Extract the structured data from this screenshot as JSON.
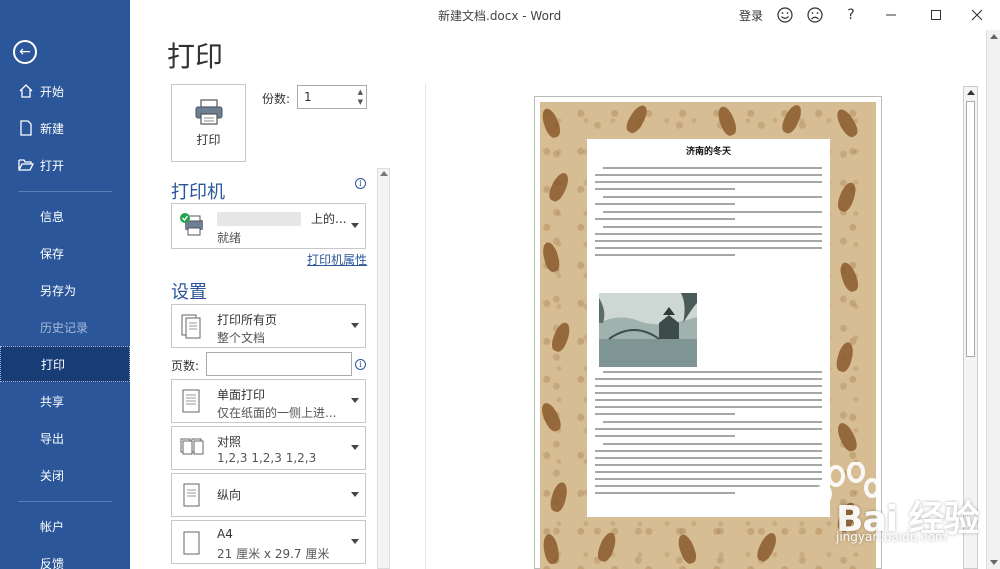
{
  "window": {
    "title": "新建文档.docx  -  Word",
    "login": "登录",
    "help": "?"
  },
  "sidebar": {
    "items": [
      {
        "label": "开始",
        "icon": "home-icon"
      },
      {
        "label": "新建",
        "icon": "new-document-icon"
      },
      {
        "label": "打开",
        "icon": "folder-open-icon"
      },
      {
        "label": "信息"
      },
      {
        "label": "保存"
      },
      {
        "label": "另存为"
      },
      {
        "label": "历史记录"
      },
      {
        "label": "打印"
      },
      {
        "label": "共享"
      },
      {
        "label": "导出"
      },
      {
        "label": "关闭"
      },
      {
        "label": "帐户"
      },
      {
        "label": "反馈"
      }
    ],
    "disabled_item": "历史记录",
    "active_item": "打印"
  },
  "print": {
    "heading": "打印",
    "print_button_label": "打印",
    "copies_label": "份数:",
    "copies_value": "1",
    "printer_section": "打印机",
    "printer_name_suffix": "上的...",
    "printer_status": "就绪",
    "printer_properties_link": "打印机属性",
    "settings_section": "设置",
    "pages_label": "页数:",
    "settings": [
      {
        "title": "打印所有页",
        "subtitle": "整个文档",
        "icon": "pages-icon"
      },
      {
        "title": "单面打印",
        "subtitle": "仅在纸面的一侧上进...",
        "icon": "one-sided-icon"
      },
      {
        "title": "对照",
        "subtitle": "1,2,3     1,2,3     1,2,3",
        "icon": "collate-icon"
      },
      {
        "title": "纵向",
        "subtitle": "",
        "icon": "portrait-icon"
      },
      {
        "title": "A4",
        "subtitle": "21 厘米 x 29.7 厘米",
        "icon": "paper-size-icon"
      }
    ]
  },
  "preview": {
    "doc_heading": "济南的冬天"
  },
  "watermark": {
    "brand": "Bai 经验",
    "url": "jingyan.baidu.com"
  },
  "colors": {
    "sidebar_bg": "#2b579a",
    "sidebar_active": "#173c76",
    "accent": "#2b579a",
    "paper_bg": "#d7bd93"
  }
}
